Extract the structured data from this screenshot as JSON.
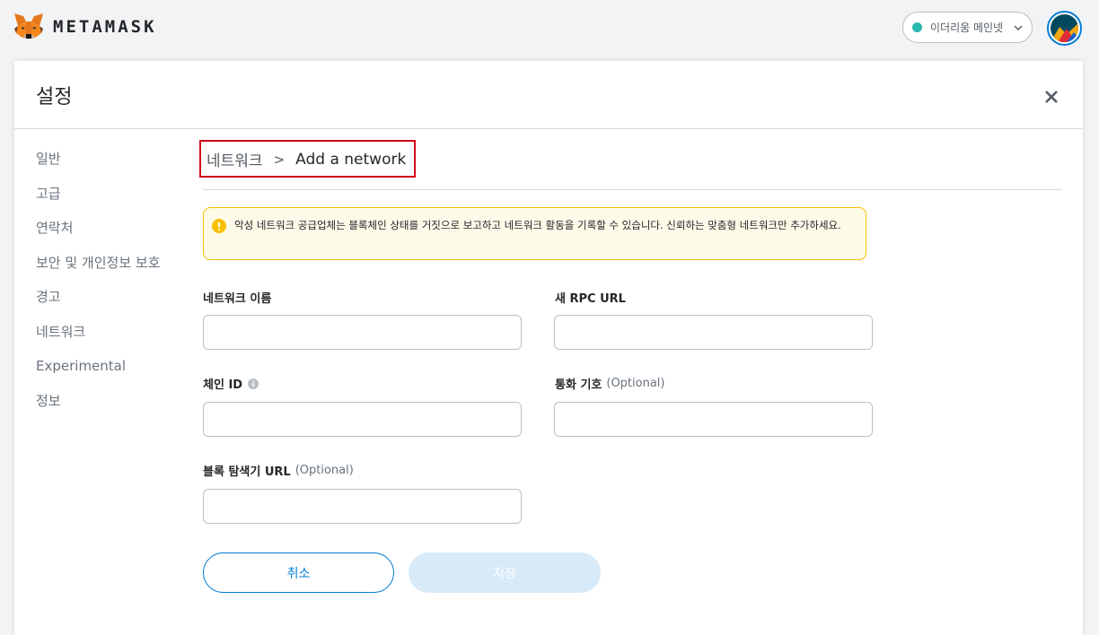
{
  "header": {
    "brand": "METAMASK",
    "network": {
      "label": "이더리움 메인넷",
      "dot_color": "#29b6af"
    },
    "account_icon": "account-avatar-icon"
  },
  "settings": {
    "title": "설정",
    "close_icon": "close-icon",
    "sidebar": [
      {
        "label": "일반"
      },
      {
        "label": "고급"
      },
      {
        "label": "연락처"
      },
      {
        "label": "보안 및 개인정보 보호"
      },
      {
        "label": "경고"
      },
      {
        "label": "네트워크"
      },
      {
        "label": "Experimental"
      },
      {
        "label": "정보"
      }
    ],
    "breadcrumb": {
      "parent": "네트워크",
      "separator": ">",
      "current": "Add a network"
    },
    "warning": {
      "icon": "warning-icon",
      "text": "악성 네트워크 공급업체는 블록체인 상태를 거짓으로 보고하고 네트워크 활동을 기록할 수 있습니다. 신뢰하는 맞춤형 네트워크만 추가하세요."
    },
    "form": {
      "network_name": {
        "label": "네트워크 이름",
        "value": ""
      },
      "rpc_url": {
        "label": "새 RPC URL",
        "value": ""
      },
      "chain_id": {
        "label": "체인 ID",
        "value": "",
        "info_icon": "info-icon"
      },
      "currency_symbol": {
        "label": "통화 기호",
        "optional": "(Optional)",
        "value": ""
      },
      "explorer_url": {
        "label": "블록 탐색기 URL",
        "optional": "(Optional)",
        "value": ""
      }
    },
    "buttons": {
      "cancel": "취소",
      "save": "저장"
    }
  },
  "colors": {
    "accent": "#037dd6",
    "highlight_box": "#d0021b",
    "warning_bg": "#fefae8",
    "warning_border": "#f8c000"
  }
}
